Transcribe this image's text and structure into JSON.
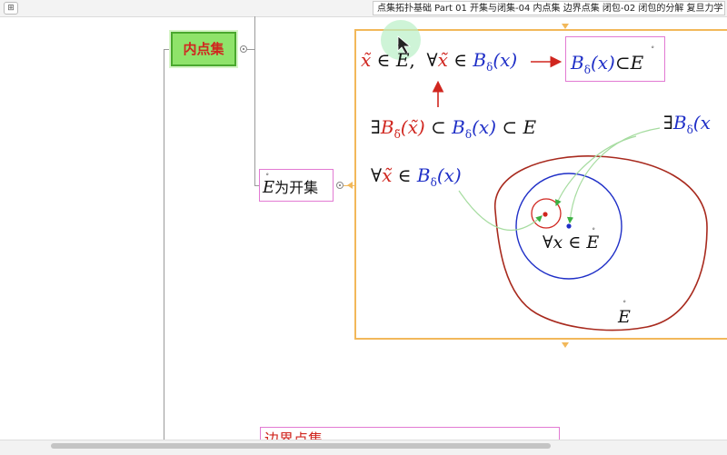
{
  "window": {
    "menu_glyph": "⊞",
    "title": "点集拓扑基础 Part 01 开集与闭集-04 内点集 边界点集 闭包-02 闭包的分解 复旦力学"
  },
  "mindmap": {
    "interior_node_label": "内点集",
    "open_set_node": {
      "E": "E",
      "ring": "∘",
      "suffix": "为开集"
    },
    "boundary_node_label": "边界点集"
  },
  "formulas": {
    "row1_left": {
      "x1": "x̃",
      "in": "∈",
      "E": "E",
      "ring": "∘",
      "comma": ",",
      "forall": "∀",
      "x2": "x̃",
      "in2": "∈",
      "B": "B",
      "delta": "δ",
      "arg": "(x)"
    },
    "result": {
      "B": "B",
      "delta": "δ",
      "arg": "(x)",
      "subset": "⊂",
      "E": "E",
      "ring": "∘"
    },
    "row2": {
      "exists": "∃",
      "B": "B",
      "delta": "δ̃",
      "arg": "(x̃)",
      "subset": "⊂",
      "B2": "B",
      "delta2": "δ",
      "arg2": "(x)",
      "subset2": "⊂",
      "E": "E"
    },
    "row3": {
      "forall": "∀",
      "x": "x̃",
      "in": "∈",
      "B": "B",
      "delta": "δ",
      "arg": "(x)"
    },
    "right_exists": {
      "exists": "∃",
      "B": "B",
      "delta": "δ",
      "arg": "(x"
    },
    "center_label": {
      "forall": "∀",
      "x": "x",
      "in": "∈",
      "E": "E",
      "ring": "∘"
    },
    "region_label": {
      "E": "E",
      "ring": "∘"
    }
  },
  "colors": {
    "red": "#d0261f",
    "blue": "#1f2fc7",
    "frame": "#f2b85a",
    "node_border": "#e27ad3",
    "green": "#8fe36a",
    "arrow_green": "#a6dca0"
  }
}
